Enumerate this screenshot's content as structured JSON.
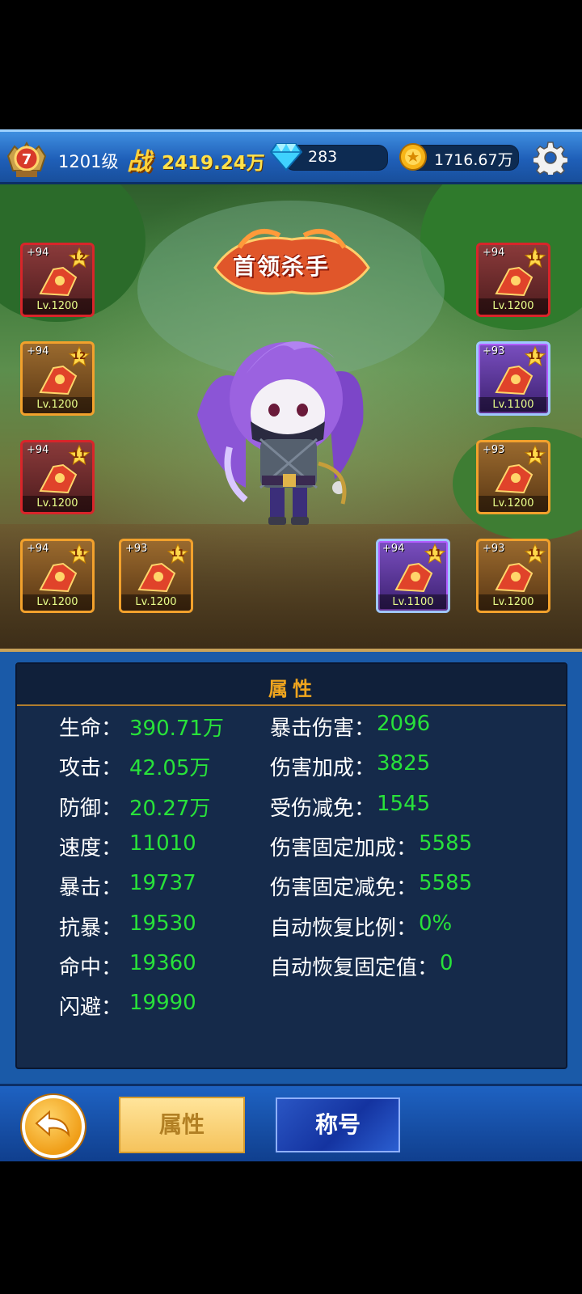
{
  "header": {
    "vip_level": "7",
    "player_level": "1201级",
    "power_label": "战",
    "power_value": "2419.24万",
    "diamond_value": "283",
    "gold_value": "1716.67万",
    "icons": [
      "rank-badge-icon",
      "diamond-icon",
      "gold-coin-icon",
      "gear-icon"
    ]
  },
  "scene": {
    "title_banner": "首领杀手"
  },
  "equipment": [
    {
      "id": "left-1",
      "plus": "+94",
      "stars": "12",
      "level": "Lv.1200",
      "rarity": "red",
      "icon": "red-sword-icon"
    },
    {
      "id": "left-2",
      "plus": "+94",
      "stars": "12",
      "level": "Lv.1200",
      "rarity": "orange",
      "icon": "armor-icon"
    },
    {
      "id": "left-3",
      "plus": "+94",
      "stars": "11",
      "level": "Lv.1200",
      "rarity": "red",
      "icon": "boots-icon"
    },
    {
      "id": "left-4",
      "plus": "+94",
      "stars": "11",
      "level": "Lv.1200",
      "rarity": "orange",
      "icon": "flame-robe-icon"
    },
    {
      "id": "left-5",
      "plus": "+93",
      "stars": "11",
      "level": "Lv.1200",
      "rarity": "orange",
      "icon": "belt-icon"
    },
    {
      "id": "right-1",
      "plus": "+94",
      "stars": "11",
      "level": "Lv.1200",
      "rarity": "red",
      "icon": "helmet-icon"
    },
    {
      "id": "right-2",
      "plus": "+93",
      "stars": "11",
      "level": "Lv.1100",
      "rarity": "purple",
      "icon": "bracer-icon"
    },
    {
      "id": "right-3",
      "plus": "+93",
      "stars": "11",
      "level": "Lv.1200",
      "rarity": "orange",
      "icon": "necklace-icon"
    },
    {
      "id": "right-4",
      "plus": "+94",
      "stars": "11",
      "level": "Lv.1100",
      "rarity": "purple",
      "icon": "ring-icon"
    },
    {
      "id": "right-5",
      "plus": "+93",
      "stars": "11",
      "level": "Lv.1200",
      "rarity": "orange",
      "icon": "gauntlet-icon"
    }
  ],
  "panel": {
    "title": "属性",
    "left_stats": [
      {
        "label": "生命：",
        "value": "390.71万"
      },
      {
        "label": "攻击：",
        "value": "42.05万"
      },
      {
        "label": "防御：",
        "value": "20.27万"
      },
      {
        "label": "速度：",
        "value": "11010"
      },
      {
        "label": "暴击：",
        "value": "19737"
      },
      {
        "label": "抗暴：",
        "value": "19530"
      },
      {
        "label": "命中：",
        "value": "19360"
      },
      {
        "label": "闪避：",
        "value": "19990"
      }
    ],
    "right_stats": [
      {
        "label": "暴击伤害：",
        "value": "2096"
      },
      {
        "label": "伤害加成：",
        "value": "3825"
      },
      {
        "label": "受伤减免：",
        "value": "1545"
      },
      {
        "label": "伤害固定加成：",
        "value": "5585"
      },
      {
        "label": "伤害固定减免：",
        "value": "5585"
      },
      {
        "label": "自动恢复比例：",
        "value": "0%"
      },
      {
        "label": "自动恢复固定值：",
        "value": "0"
      }
    ]
  },
  "bottom": {
    "tab_attributes": "属性",
    "tab_titles": "称号",
    "back_icon": "back-arrow-icon"
  },
  "colors": {
    "stat_value": "#28e23a",
    "panel_title": "#f0a51e",
    "slot_red": "#d8252a",
    "slot_orange": "#f2a12c",
    "slot_purple": "#9fc6ff"
  }
}
